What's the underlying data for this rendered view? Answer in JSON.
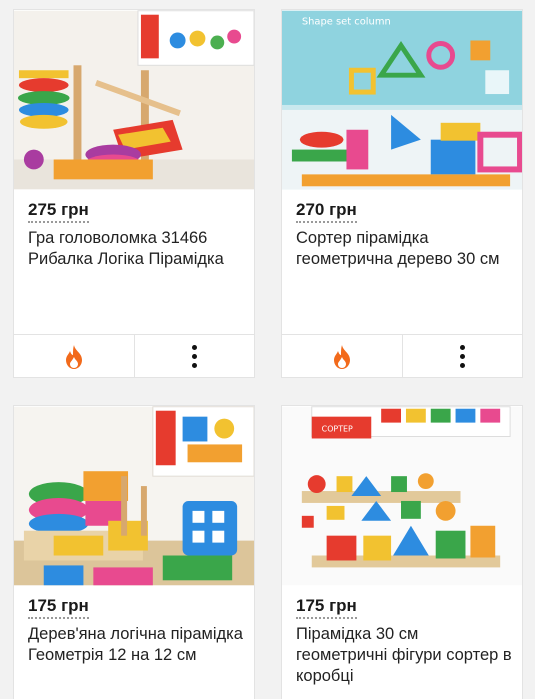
{
  "products": [
    {
      "price": "275 грн",
      "title": "Гра головоломка 31466 Рибалка Логіка Пірамідка",
      "image_icon": "wooden-fishing-pyramid-image"
    },
    {
      "price": "270 грн",
      "title": "Сортер пірамідка геометрична дерево 30 см",
      "image_icon": "shape-sorter-column-image",
      "box_text": "Shape set column"
    },
    {
      "price": "175 грн",
      "title": "Дерев'яна логічна пірамідка Геометрія 12 на 12 см",
      "image_icon": "geometry-pyramid-image"
    },
    {
      "price": "175 грн",
      "title": "Пірамідка 30 см геометричні фігури сортер в коробці",
      "image_icon": "sorter-in-box-image",
      "box_text": "СОРТЕР"
    }
  ],
  "actions": {
    "hot_icon": "fire-icon",
    "menu_icon": "more-vertical-icon"
  },
  "colors": {
    "fire": "#f26a1b",
    "card_border": "#e3e3e3",
    "background": "#f2f2f2"
  }
}
